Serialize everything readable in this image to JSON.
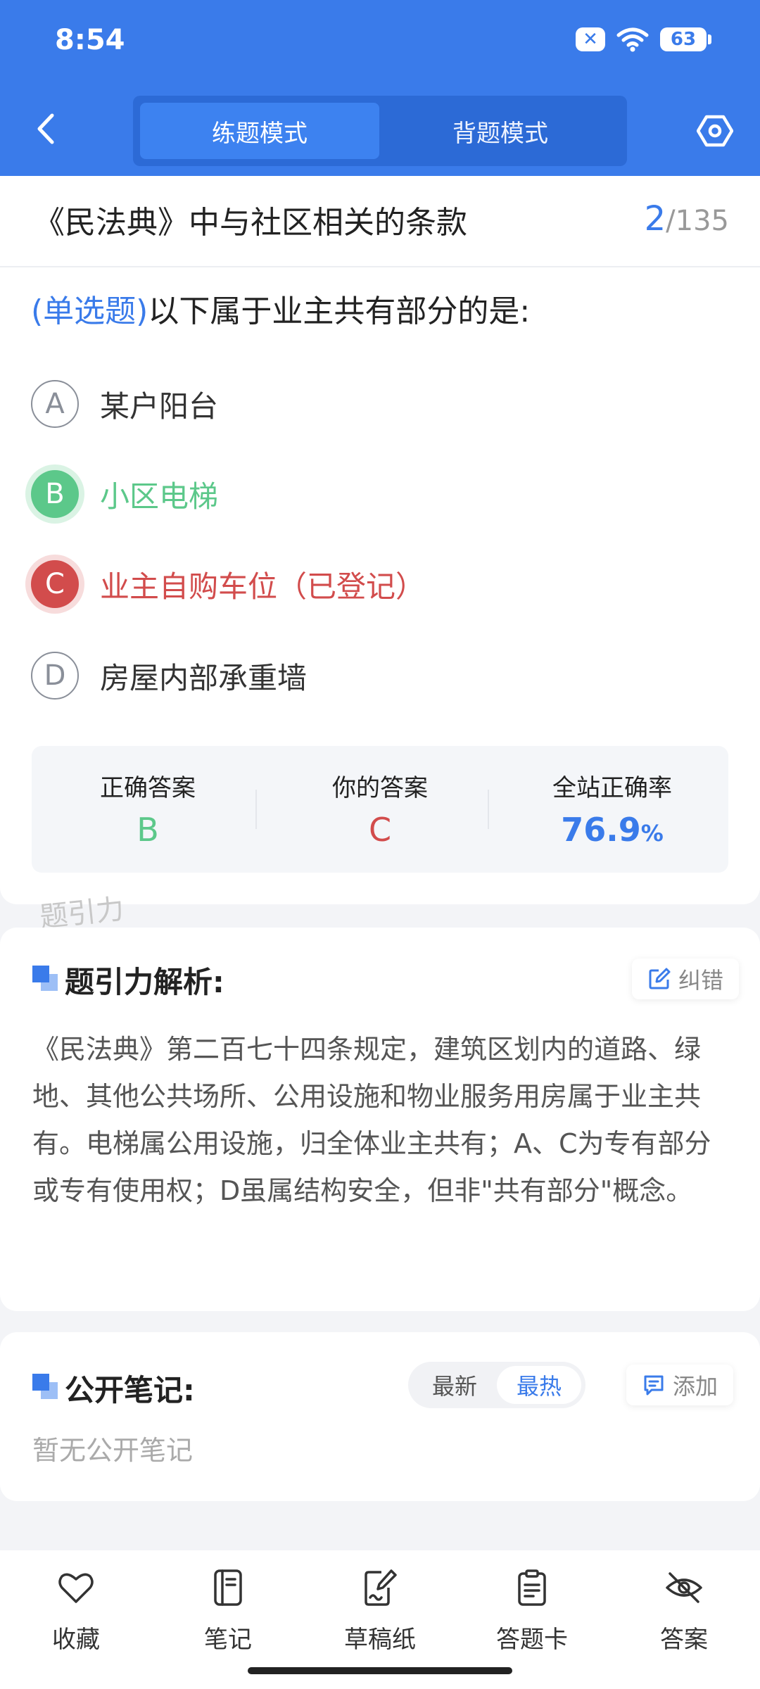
{
  "status_bar": {
    "time": "8:54",
    "battery": "63"
  },
  "header": {
    "mode_tabs": [
      "练题模式",
      "背题模式"
    ],
    "active_tab": 0
  },
  "chapter": {
    "title": "《民法典》中与社区相关的条款",
    "progress_current": "2",
    "progress_total": "/135"
  },
  "question": {
    "type": "(单选题)",
    "text": "以下属于业主共有部分的是:",
    "options": [
      {
        "letter": "A",
        "text": "某户阳台",
        "state": "normal"
      },
      {
        "letter": "B",
        "text": "小区电梯",
        "state": "correct"
      },
      {
        "letter": "C",
        "text": "业主自购车位（已登记）",
        "state": "wrong"
      },
      {
        "letter": "D",
        "text": "房屋内部承重墙",
        "state": "normal"
      }
    ]
  },
  "result": {
    "correct_label": "正确答案",
    "correct_value": "B",
    "yours_label": "你的答案",
    "yours_value": "C",
    "rate_label": "全站正确率",
    "rate_value": "76.9",
    "rate_unit": "%"
  },
  "watermark": "题引力",
  "analysis": {
    "title": "题引力解析:",
    "report_label": "纠错",
    "text": "《民法典》第二百七十四条规定，建筑区划内的道路、绿地、其他公共场所、公用设施和物业服务用房属于业主共有。电梯属公用设施，归全体业主共有；A、C为专有部分或专有使用权；D虽属结构安全，但非\"共有部分\"概念。"
  },
  "notes": {
    "title": "公开笔记:",
    "sort_options": [
      "最新",
      "最热"
    ],
    "active_sort": 1,
    "add_label": "添加",
    "empty_text": "暂无公开笔记"
  },
  "bottom_nav": [
    {
      "label": "收藏",
      "icon": "heart-icon"
    },
    {
      "label": "笔记",
      "icon": "notebook-icon"
    },
    {
      "label": "草稿纸",
      "icon": "draft-paper-icon"
    },
    {
      "label": "答题卡",
      "icon": "answer-card-icon"
    },
    {
      "label": "答案",
      "icon": "eye-off-icon"
    }
  ],
  "colors": {
    "brand": "#3a7bea",
    "correct": "#5cc88a",
    "wrong": "#d24c4c"
  }
}
